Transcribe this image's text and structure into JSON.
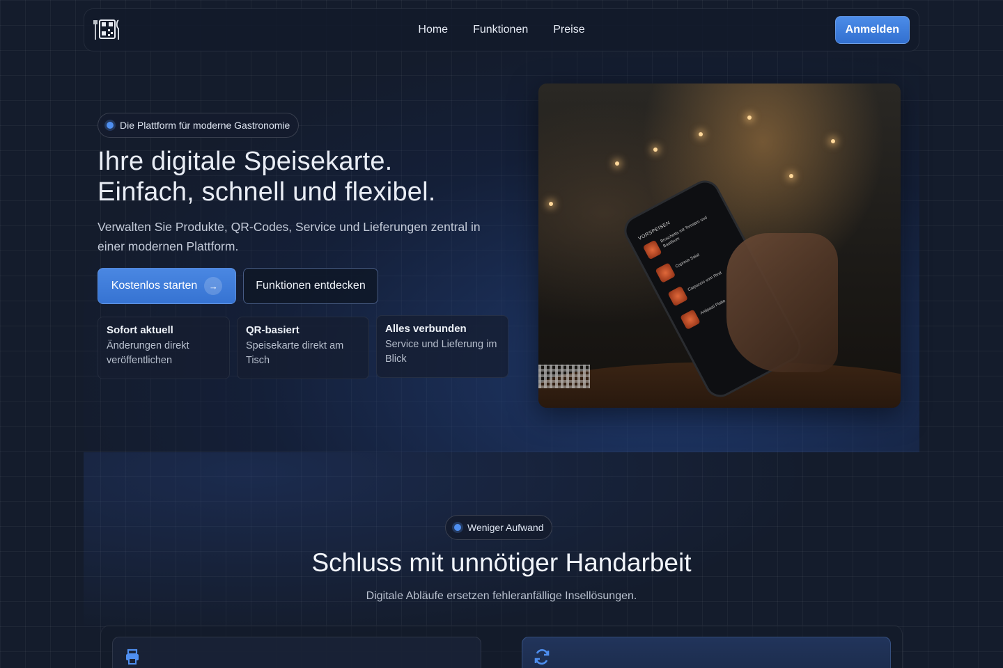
{
  "nav": {
    "logo_icon": "qr-menu-logo-icon",
    "links": [
      "Home",
      "Funktionen",
      "Preise"
    ],
    "login_label": "Anmelden"
  },
  "hero": {
    "badge": "Die Plattform für moderne Gastronomie",
    "title_line1": "Ihre digitale Speisekarte.",
    "title_line2": "Einfach, schnell und flexibel.",
    "subtitle": "Verwalten Sie Produkte, QR-Codes, Service und Lieferungen zentral in einer modernen Plattform.",
    "cta_primary": "Kostenlos starten",
    "cta_primary_icon": "arrow-right-icon",
    "cta_secondary": "Funktionen entdecken",
    "features": [
      {
        "title": "Sofort aktuell",
        "desc": "Änderungen direkt veröffentlichen"
      },
      {
        "title": "QR-basiert",
        "desc": "Speisekarte direkt am Tisch"
      },
      {
        "title": "Alles verbunden",
        "desc": "Service und Lieferung im Blick"
      }
    ],
    "image_alt": "restaurant-phone-menu-photo",
    "phone_screen": {
      "heading": "VORSPEISEN",
      "items": [
        "Bruschetta mit Tomaten und Basilikum",
        "Caprese Salat",
        "Carpaccio vom Rind",
        "Antipasti Platte"
      ]
    }
  },
  "section2": {
    "badge": "Weniger Aufwand",
    "title": "Schluss mit unnötiger Handarbeit",
    "subtitle": "Digitale Abläufe ersetzen fehleranfällige Insellösungen.",
    "cards": [
      {
        "icon": "printer-icon"
      },
      {
        "icon": "sync-icon"
      }
    ]
  },
  "colors": {
    "background": "#141c2c",
    "accent": "#3f7fe0",
    "text": "#e6ebf5"
  }
}
